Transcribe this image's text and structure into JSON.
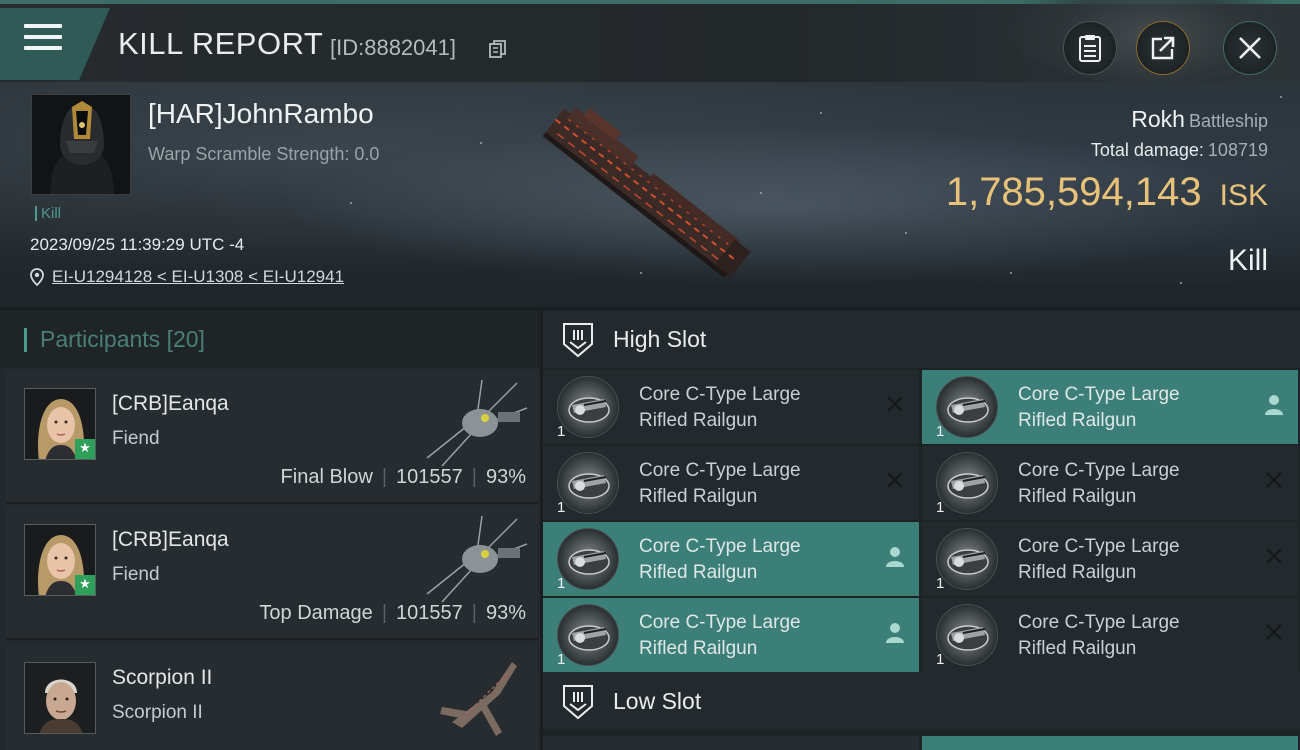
{
  "header": {
    "title": "KILL REPORT",
    "report_id": "[ID:8882041]"
  },
  "victim": {
    "name": "[HAR]JohnRambo",
    "warp_scramble": "Warp Scramble Strength: 0.0",
    "kill_tag": "Kill",
    "datetime": "2023/09/25 11:39:29 UTC -4",
    "location": "EI-U1294128 < EI-U1308 < EI-U12941",
    "ship_name": "Rokh",
    "ship_class": "Battleship",
    "total_damage_label": "Total damage:",
    "total_damage": "108719",
    "isk_value": "1,785,594,143",
    "isk_unit": "ISK",
    "result": "Kill"
  },
  "participants": {
    "label": "Participants",
    "count": "[20]",
    "rows": [
      {
        "name": "[CRB]Eanqa",
        "ship": "Fiend",
        "role": "Final Blow",
        "damage": "101557",
        "percent": "93%"
      },
      {
        "name": "[CRB]Eanqa",
        "ship": "Fiend",
        "role": "Top Damage",
        "damage": "101557",
        "percent": "93%"
      },
      {
        "name": "Scorpion II",
        "ship": "Scorpion II",
        "role": "",
        "damage": "",
        "percent": ""
      }
    ]
  },
  "high_slot": {
    "title": "High Slot",
    "modules": [
      {
        "line1": "Core C-Type Large",
        "line2": "Rifled Railgun",
        "qty": "1",
        "state": "destroyed"
      },
      {
        "line1": "Core C-Type Large",
        "line2": "Rifled Railgun",
        "qty": "1",
        "state": "dropped"
      },
      {
        "line1": "Core C-Type Large",
        "line2": "Rifled Railgun",
        "qty": "1",
        "state": "destroyed"
      },
      {
        "line1": "Core C-Type Large",
        "line2": "Rifled Railgun",
        "qty": "1",
        "state": "destroyed"
      },
      {
        "line1": "Core C-Type Large",
        "line2": "Rifled Railgun",
        "qty": "1",
        "state": "dropped"
      },
      {
        "line1": "Core C-Type Large",
        "line2": "Rifled Railgun",
        "qty": "1",
        "state": "destroyed"
      },
      {
        "line1": "Core C-Type Large",
        "line2": "Rifled Railgun",
        "qty": "1",
        "state": "dropped"
      },
      {
        "line1": "Core C-Type Large",
        "line2": "Rifled Railgun",
        "qty": "1",
        "state": "destroyed"
      }
    ]
  },
  "low_slot": {
    "title": "Low Slot"
  },
  "colors": {
    "accent_teal": "#3c7f78",
    "isk_gold": "#e9c27a",
    "badge_green": "#2fa05a"
  },
  "icons": {
    "menu": "hamburger-menu-icon",
    "copy": "copy-icon",
    "clipboard": "clipboard-icon",
    "share": "share-icon",
    "close": "close-icon",
    "location": "location-pin-icon",
    "slot": "slot-shield-icon",
    "destroyed": "x-icon",
    "dropped": "pilot-icon"
  }
}
